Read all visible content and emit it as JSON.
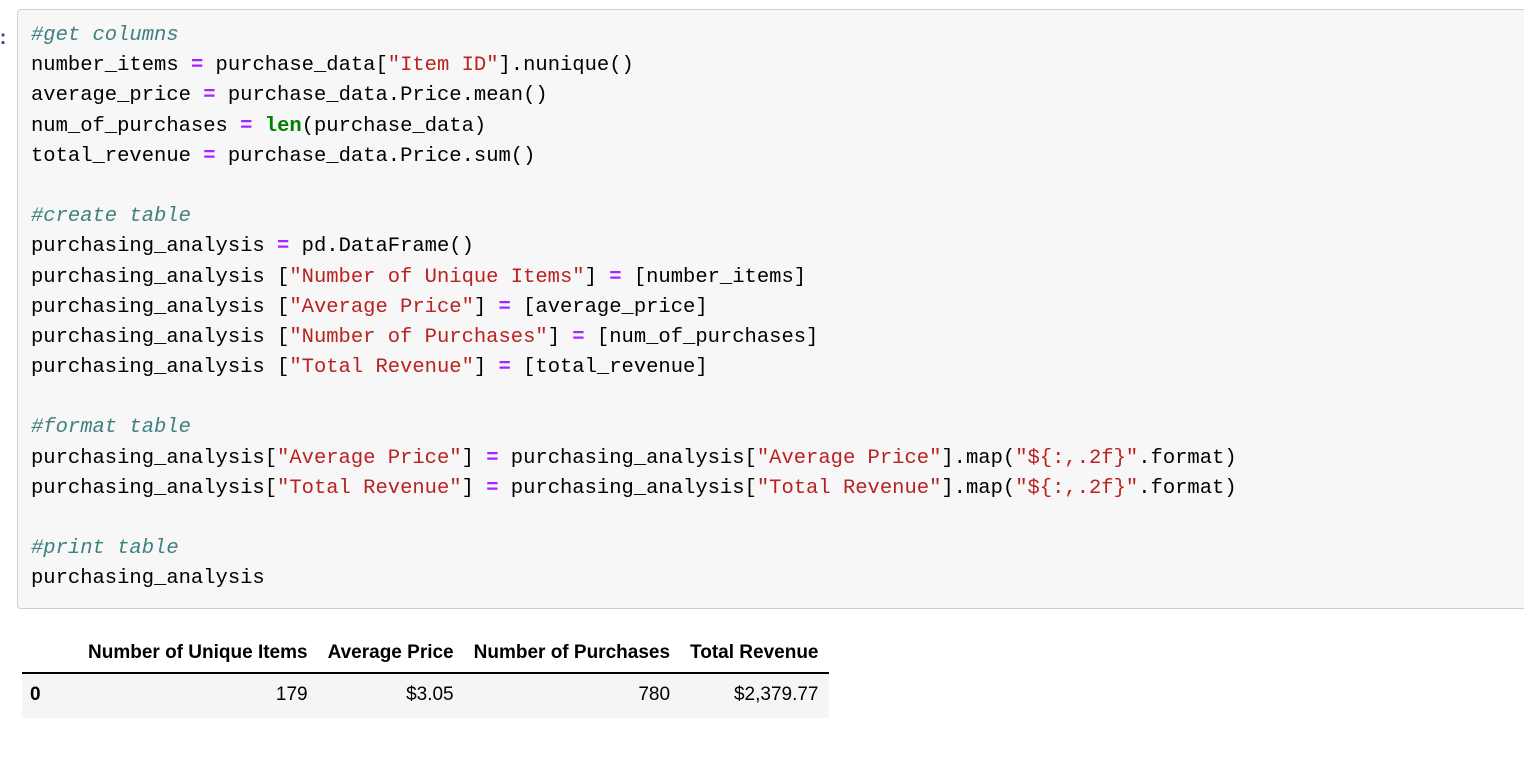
{
  "notebook": {
    "input_prompt": "]:",
    "output_prompt": ":",
    "colors": {
      "comment": "#408080",
      "string": "#ba2121",
      "operator": "#aa22ff",
      "builtin": "#008000",
      "cell_background": "#f7f7f7",
      "input_prompt": "#303f9f",
      "output_prompt": "#d84315",
      "table_row_background": "#f5f5f5"
    }
  },
  "code": {
    "lines": [
      [
        {
          "t": "c",
          "v": "#get columns"
        }
      ],
      [
        {
          "t": "n",
          "v": "number_items "
        },
        {
          "t": "o",
          "v": "="
        },
        {
          "t": "n",
          "v": " purchase_data["
        },
        {
          "t": "s",
          "v": "\"Item ID\""
        },
        {
          "t": "n",
          "v": "].nunique()"
        }
      ],
      [
        {
          "t": "n",
          "v": "average_price "
        },
        {
          "t": "o",
          "v": "="
        },
        {
          "t": "n",
          "v": " purchase_data.Price.mean()"
        }
      ],
      [
        {
          "t": "n",
          "v": "num_of_purchases "
        },
        {
          "t": "o",
          "v": "="
        },
        {
          "t": "n",
          "v": " "
        },
        {
          "t": "nb",
          "v": "len"
        },
        {
          "t": "n",
          "v": "(purchase_data)"
        }
      ],
      [
        {
          "t": "n",
          "v": "total_revenue "
        },
        {
          "t": "o",
          "v": "="
        },
        {
          "t": "n",
          "v": " purchase_data.Price.sum()"
        }
      ],
      [],
      [
        {
          "t": "c",
          "v": "#create table"
        }
      ],
      [
        {
          "t": "n",
          "v": "purchasing_analysis "
        },
        {
          "t": "o",
          "v": "="
        },
        {
          "t": "n",
          "v": " pd.DataFrame()"
        }
      ],
      [
        {
          "t": "n",
          "v": "purchasing_analysis ["
        },
        {
          "t": "s",
          "v": "\"Number of Unique Items\""
        },
        {
          "t": "n",
          "v": "] "
        },
        {
          "t": "o",
          "v": "="
        },
        {
          "t": "n",
          "v": " [number_items]"
        }
      ],
      [
        {
          "t": "n",
          "v": "purchasing_analysis ["
        },
        {
          "t": "s",
          "v": "\"Average Price\""
        },
        {
          "t": "n",
          "v": "] "
        },
        {
          "t": "o",
          "v": "="
        },
        {
          "t": "n",
          "v": " [average_price]"
        }
      ],
      [
        {
          "t": "n",
          "v": "purchasing_analysis ["
        },
        {
          "t": "s",
          "v": "\"Number of Purchases\""
        },
        {
          "t": "n",
          "v": "] "
        },
        {
          "t": "o",
          "v": "="
        },
        {
          "t": "n",
          "v": " [num_of_purchases]"
        }
      ],
      [
        {
          "t": "n",
          "v": "purchasing_analysis ["
        },
        {
          "t": "s",
          "v": "\"Total Revenue\""
        },
        {
          "t": "n",
          "v": "] "
        },
        {
          "t": "o",
          "v": "="
        },
        {
          "t": "n",
          "v": " [total_revenue]"
        }
      ],
      [],
      [
        {
          "t": "c",
          "v": "#format table"
        }
      ],
      [
        {
          "t": "n",
          "v": "purchasing_analysis["
        },
        {
          "t": "s",
          "v": "\"Average Price\""
        },
        {
          "t": "n",
          "v": "] "
        },
        {
          "t": "o",
          "v": "="
        },
        {
          "t": "n",
          "v": " purchasing_analysis["
        },
        {
          "t": "s",
          "v": "\"Average Price\""
        },
        {
          "t": "n",
          "v": "].map("
        },
        {
          "t": "s",
          "v": "\"${:,.2f}\""
        },
        {
          "t": "n",
          "v": ".format)"
        }
      ],
      [
        {
          "t": "n",
          "v": "purchasing_analysis["
        },
        {
          "t": "s",
          "v": "\"Total Revenue\""
        },
        {
          "t": "n",
          "v": "] "
        },
        {
          "t": "o",
          "v": "="
        },
        {
          "t": "n",
          "v": " purchasing_analysis["
        },
        {
          "t": "s",
          "v": "\"Total Revenue\""
        },
        {
          "t": "n",
          "v": "].map("
        },
        {
          "t": "s",
          "v": "\"${:,.2f}\""
        },
        {
          "t": "n",
          "v": ".format)"
        }
      ],
      [],
      [
        {
          "t": "c",
          "v": "#print table"
        }
      ],
      [
        {
          "t": "n",
          "v": "purchasing_analysis"
        }
      ]
    ]
  },
  "output_table": {
    "index_header": "",
    "columns": [
      "Number of Unique Items",
      "Average Price",
      "Number of Purchases",
      "Total Revenue"
    ],
    "rows": [
      {
        "index": "0",
        "cells": [
          "179",
          "$3.05",
          "780",
          "$2,379.77"
        ]
      }
    ]
  }
}
